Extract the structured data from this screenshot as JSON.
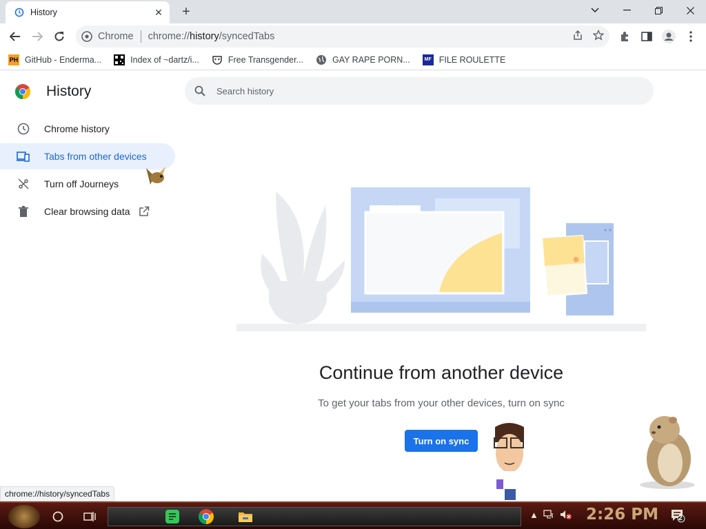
{
  "tab": {
    "title": "History",
    "favicon": "history-icon"
  },
  "window_controls": [
    "chevron-down-icon",
    "minimize-icon",
    "restore-icon",
    "close-icon"
  ],
  "toolbar": {
    "site_label": "Chrome",
    "url_prefix": "chrome://",
    "url_host": "history",
    "url_path": "/syncedTabs"
  },
  "bookmarks": [
    {
      "label": "GitHub - Enderma...",
      "icon": "ph-icon"
    },
    {
      "label": "Index of ~dartz/i...",
      "icon": "qr-icon"
    },
    {
      "label": "Free Transgender...",
      "icon": "mask-icon"
    },
    {
      "label": "GAY RAPE PORN...",
      "icon": "globe-icon"
    },
    {
      "label": "FILE ROULETTE",
      "icon": "mf-icon"
    }
  ],
  "sidebar": {
    "title": "History",
    "items": [
      {
        "label": "Chrome history",
        "icon": "clock-icon",
        "active": false
      },
      {
        "label": "Tabs from other devices",
        "icon": "devices-icon",
        "active": true
      },
      {
        "label": "Turn off Journeys",
        "icon": "journeys-off-icon",
        "active": false
      },
      {
        "label": "Clear browsing data",
        "icon": "trash-icon",
        "active": false
      }
    ]
  },
  "search": {
    "placeholder": "Search history"
  },
  "main": {
    "headline": "Continue from another device",
    "subline": "To get your tabs from your other devices, turn on sync",
    "sync_button": "Turn on sync"
  },
  "status_bubble": "chrome://history/syncedTabs",
  "taskbar": {
    "clock": "2:26 PM",
    "notification_count": "2"
  },
  "colors": {
    "accent": "#1a73e8",
    "active_nav_bg": "#e8f0fe",
    "active_nav_text": "#1967d2",
    "taskbar": "#3a0c08"
  }
}
